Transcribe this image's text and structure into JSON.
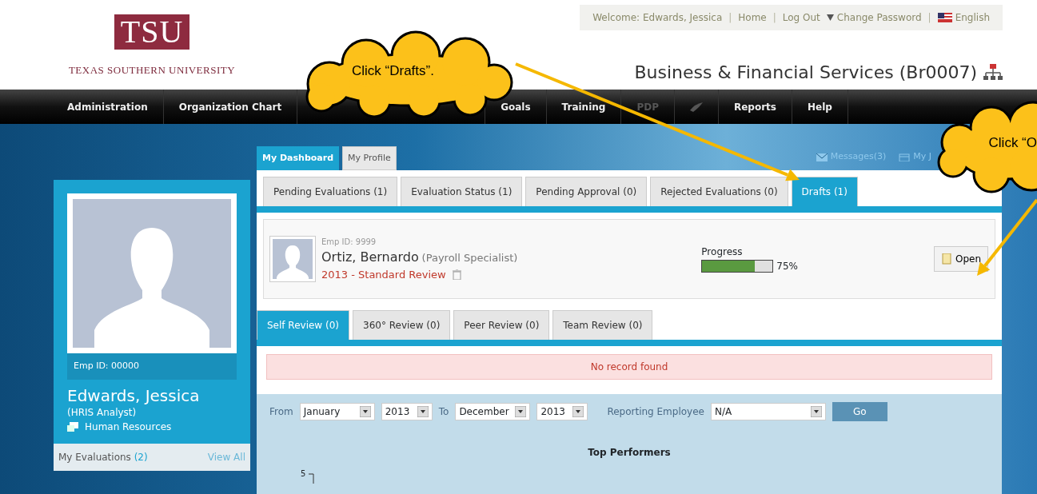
{
  "header": {
    "logo_text": "TSU",
    "university": "TEXAS SOUTHERN UNIVERSITY",
    "welcome": "Welcome: Edwards, Jessica",
    "links": [
      {
        "kind": "separator",
        "text": "|"
      },
      {
        "kind": "link",
        "text": "Home"
      },
      {
        "kind": "separator",
        "text": "|"
      },
      {
        "kind": "link",
        "text": "Log Out"
      }
    ],
    "change_password": "Change Password",
    "separator": "|",
    "language": "English",
    "title": "Business & Financial Services (Br0007)"
  },
  "nav": [
    {
      "kind": "text",
      "label": "Administration",
      "disabled": false
    },
    {
      "kind": "text",
      "label": "Organization Chart",
      "disabled": false
    },
    {
      "kind": "spacer"
    },
    {
      "kind": "text",
      "label": "Goals",
      "disabled": false
    },
    {
      "kind": "text",
      "label": "Training",
      "disabled": false
    },
    {
      "kind": "text",
      "label": "PDP",
      "disabled": true
    },
    {
      "kind": "icon",
      "disabled": true
    },
    {
      "kind": "text",
      "label": "Reports",
      "disabled": false
    },
    {
      "kind": "text",
      "label": "Help",
      "disabled": false
    }
  ],
  "sidebar": {
    "emp_id": "Emp ID: 00000",
    "name": "Edwards, Jessica",
    "role": "(HRIS Analyst)",
    "department": "Human Resources",
    "evaluations_label": "My Evaluations",
    "evaluations_count": "(2)",
    "view_all": "View All"
  },
  "profile_tabs": [
    {
      "label": "My Dashboard",
      "selected": true
    },
    {
      "label": "My Profile",
      "selected": false
    }
  ],
  "header_links": [
    "Messages(3)",
    "My J"
  ],
  "eval_tabs": [
    {
      "label": "Pending Evaluations (1)",
      "selected": false
    },
    {
      "label": "Evaluation Status (1)",
      "selected": false
    },
    {
      "label": "Pending Approval (0)",
      "selected": false
    },
    {
      "label": "Rejected Evaluations (0)",
      "selected": false
    },
    {
      "label": "Drafts (1)",
      "selected": true
    }
  ],
  "draft": {
    "emp_id": "Emp ID: 9999",
    "name": "Ortiz, Bernardo",
    "role": "(Payroll Specialist)",
    "review": "2013 - Standard Review",
    "progress_label": "Progress",
    "level": 0.75,
    "reading": "75%",
    "open_button": "Open"
  },
  "review_tabs": [
    {
      "label": "Self Review (0)",
      "selected": true
    },
    {
      "label": "360° Review (0)",
      "selected": false
    },
    {
      "label": "Peer Review (0)",
      "selected": false
    },
    {
      "label": "Team Review (0)",
      "selected": false
    }
  ],
  "no_record": "No record found",
  "filters": {
    "from_label": "From",
    "from_month": "January",
    "from_year": "2013",
    "to_label": "To",
    "to_month": "December",
    "to_year": "2013",
    "reporting_label": "Reporting Employee",
    "reporting_value": "N/A",
    "go": "Go"
  },
  "chart": {
    "title": "Top Performers",
    "y_tick": "5"
  },
  "callouts": [
    {
      "text": "Click “Drafts”."
    },
    {
      "text": "Click “O"
    }
  ]
}
